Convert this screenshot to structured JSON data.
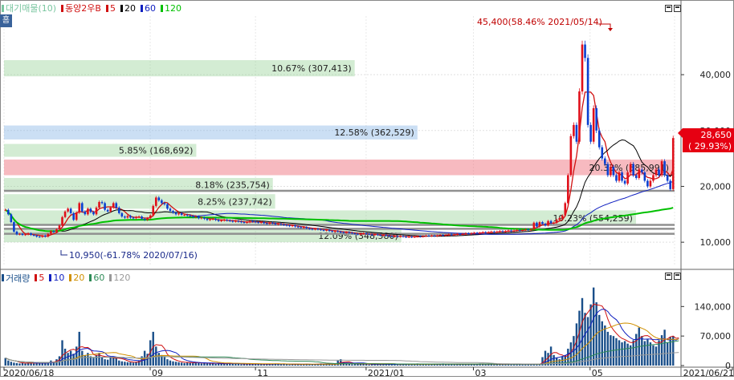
{
  "legend": {
    "ma_square_color": "#7ac6a0",
    "items": [
      {
        "label": "대기매물(10)",
        "color": "#7ac6a0"
      },
      {
        "label": "동양2우B",
        "color": "#d01010"
      },
      {
        "label": "5",
        "color": "#d01010"
      },
      {
        "label": "20",
        "color": "#000000"
      },
      {
        "label": "60",
        "color": "#1020c0"
      },
      {
        "label": "120",
        "color": "#00c000"
      }
    ]
  },
  "home_button": "홈",
  "price_axis": {
    "min": 6000,
    "max": 50500,
    "ticks": [
      {
        "value": 40000,
        "label": "40,000"
      },
      {
        "value": 30000,
        "label": "30,000"
      },
      {
        "value": 20000,
        "label": "20,000"
      },
      {
        "value": 10000,
        "label": "10,000"
      }
    ],
    "current_price": {
      "value": 28650,
      "label": "28,650",
      "change": "( 29.93%)"
    }
  },
  "annotations": {
    "high": "45,400(58.46% 2021/05/14)",
    "low": "10,950(-61.78% 2020/07/16)"
  },
  "volume_profile": [
    {
      "label": "10.67% (307,413)",
      "from": 39700,
      "to": 42600,
      "kind": "green"
    },
    {
      "label": "12.58% (362,529)",
      "from": 28400,
      "to": 30900,
      "kind": "blue"
    },
    {
      "label": "5.85% (168,692)",
      "from": 25300,
      "to": 27600,
      "kind": "green"
    },
    {
      "label": "20.33% (585,991)",
      "from": 22000,
      "to": 24800,
      "kind": "red"
    },
    {
      "label": "8.18% (235,754)",
      "from": 19000,
      "to": 21500,
      "kind": "green"
    },
    {
      "label": "8.25% (237,742)",
      "from": 16000,
      "to": 18600,
      "kind": "green"
    },
    {
      "label": "19.23% (554,259)",
      "from": 13000,
      "to": 15700,
      "kind": "green"
    },
    {
      "label": "12.09% (348,580)",
      "from": 10000,
      "to": 12400,
      "kind": "green"
    }
  ],
  "resistance_lines": [
    19200,
    13100,
    12400,
    11500
  ],
  "volume_legend": [
    {
      "label": "거래량",
      "color": "#1a4f8a"
    },
    {
      "label": "5",
      "color": "#d01010"
    },
    {
      "label": "10",
      "color": "#1020c0"
    },
    {
      "label": "20",
      "color": "#d09000"
    },
    {
      "label": "60",
      "color": "#2e8b57"
    },
    {
      "label": "120",
      "color": "#999999"
    }
  ],
  "volume_axis": {
    "max": 190000,
    "ticks": [
      {
        "value": 140000,
        "label": "140,000"
      },
      {
        "value": 70000,
        "label": "70,000"
      },
      {
        "value": 0,
        "label": "0"
      }
    ]
  },
  "x_axis": {
    "labels": [
      {
        "label": "2020/06/18",
        "pos": 0.0
      },
      {
        "label": "09",
        "pos": 0.218
      },
      {
        "label": "11",
        "pos": 0.375
      },
      {
        "label": "2021/01",
        "pos": 0.54
      },
      {
        "label": "03",
        "pos": 0.7
      },
      {
        "label": "05",
        "pos": 0.874
      },
      {
        "label": "2021/06/21",
        "pos": 1.0
      }
    ]
  },
  "chart_data": {
    "type": "candlestick",
    "ylim": [
      6000,
      50500
    ],
    "x_start": "2020/06/18",
    "x_end": "2021/06/21",
    "closes": [
      15800,
      15000,
      13600,
      11900,
      11400,
      11500,
      11300,
      11400,
      11600,
      11300,
      11200,
      11000,
      10950,
      11200,
      11000,
      11500,
      12000,
      11800,
      12300,
      13000,
      14500,
      15500,
      16000,
      15200,
      14000,
      15300,
      17000,
      15500,
      15000,
      16000,
      15400,
      15000,
      16200,
      17200,
      17000,
      15800,
      15500,
      16200,
      17000,
      16200,
      15200,
      14600,
      14400,
      14700,
      14400,
      14300,
      14500,
      14600,
      14200,
      14000,
      14300,
      14800,
      16500,
      18000,
      17500,
      17000,
      16800,
      16000,
      15600,
      15300,
      15000,
      15200,
      14900,
      14900,
      14800,
      14700,
      14500,
      14600,
      14300,
      14400,
      14200,
      14000,
      14100,
      14200,
      14000,
      13800,
      13900,
      14000,
      13900,
      13800,
      13700,
      13800,
      13700,
      13600,
      13500,
      13600,
      13800,
      13700,
      13600,
      13500,
      13600,
      13400,
      13300,
      13500,
      13400,
      13200,
      13300,
      13200,
      13100,
      13000,
      12900,
      13000,
      12800,
      12700,
      12600,
      12700,
      12500,
      12400,
      12300,
      12400,
      12300,
      12200,
      12100,
      12200,
      12000,
      11900,
      12000,
      11900,
      11800,
      11700,
      11800,
      11700,
      11600,
      11500,
      11400,
      11500,
      11600,
      11500,
      11400,
      11300,
      11400,
      11300,
      11200,
      11300,
      11200,
      11100,
      11000,
      11100,
      11000,
      11100,
      11000,
      10900,
      11000,
      10900,
      11000,
      11100,
      11000,
      11100,
      11200,
      11100,
      11200,
      11100,
      11200,
      11300,
      11200,
      11300,
      11400,
      11300,
      11400,
      11500,
      11400,
      11500,
      11600,
      11500,
      11600,
      11700,
      11600,
      11700,
      11800,
      11700,
      11800,
      11900,
      11800,
      11900,
      12000,
      11900,
      12000,
      12100,
      12000,
      12100,
      12200,
      12100,
      12200,
      12300,
      12200,
      12300,
      13500,
      12800,
      13600,
      13300,
      13000,
      13800,
      13400,
      13500,
      14000,
      14300,
      14800,
      17000,
      22000,
      29000,
      31000,
      28000,
      37000,
      45400,
      43000,
      31000,
      28000,
      34000,
      30000,
      27000,
      25000,
      24000,
      22000,
      23500,
      22000,
      21000,
      22500,
      21000,
      20500,
      22500,
      24000,
      22000,
      21500,
      23000,
      22500,
      21000,
      20000,
      21000,
      22000,
      23000,
      22000,
      24500,
      22000,
      21000,
      19500,
      28650
    ],
    "volumes": [
      18000,
      12000,
      9000,
      7000,
      6000,
      5000,
      6000,
      5000,
      7000,
      6000,
      5000,
      6000,
      5000,
      7000,
      6000,
      8000,
      12000,
      9000,
      15000,
      22000,
      60000,
      40000,
      30000,
      35000,
      28000,
      45000,
      80000,
      35000,
      25000,
      30000,
      22000,
      18000,
      25000,
      30000,
      20000,
      15000,
      14000,
      20000,
      22000,
      18000,
      12000,
      10000,
      9000,
      8000,
      8000,
      7000,
      9000,
      12000,
      22000,
      35000,
      28000,
      60000,
      80000,
      45000,
      30000,
      25000,
      20000,
      15000,
      12000,
      10000,
      9000,
      8000,
      7000,
      6000,
      8000,
      7000,
      6000,
      7000,
      6000,
      5000,
      6000,
      5000,
      6000,
      5000,
      4000,
      5000,
      4000,
      5000,
      6000,
      5000,
      4000,
      5000,
      4000,
      3000,
      4000,
      5000,
      4000,
      3000,
      4000,
      3000,
      4000,
      3000,
      4000,
      3000,
      4000,
      5000,
      4000,
      3000,
      4000,
      3000,
      2000,
      3000,
      4000,
      3000,
      2000,
      3000,
      4000,
      3000,
      2000,
      3000,
      4000,
      5000,
      3000,
      4000,
      3000,
      2000,
      3000,
      12000,
      15000,
      8000,
      5000,
      4000,
      3000,
      4000,
      5000,
      3000,
      4000,
      3000,
      2000,
      3000,
      4000,
      3000,
      2000,
      3000,
      4000,
      3000,
      2000,
      3000,
      2000,
      3000,
      4000,
      3000,
      2000,
      3000,
      4000,
      5000,
      3000,
      4000,
      3000,
      2000,
      3000,
      4000,
      3000,
      4000,
      5000,
      3000,
      4000,
      3000,
      2000,
      3000,
      4000,
      3000,
      2000,
      3000,
      4000,
      3000,
      4000,
      5000,
      4000,
      3000,
      4000,
      3000,
      2000,
      3000,
      4000,
      3000,
      4000,
      3000,
      2000,
      3000,
      4000,
      3000,
      2000,
      3000,
      4000,
      3000,
      2000,
      3000,
      4000,
      20000,
      35000,
      30000,
      45000,
      25000,
      18000,
      15000,
      22000,
      25000,
      40000,
      55000,
      70000,
      100000,
      130000,
      160000,
      125000,
      115000,
      145000,
      185000,
      150000,
      120000,
      105000,
      95000,
      80000,
      72000,
      70000,
      65000,
      60000,
      55000,
      58000,
      52000,
      48000,
      60000,
      75000,
      90000,
      70000,
      58000,
      62000,
      55000,
      48000,
      45000,
      60000,
      72000,
      85000,
      55000,
      68000,
      70000,
      45000,
      90000
    ]
  }
}
